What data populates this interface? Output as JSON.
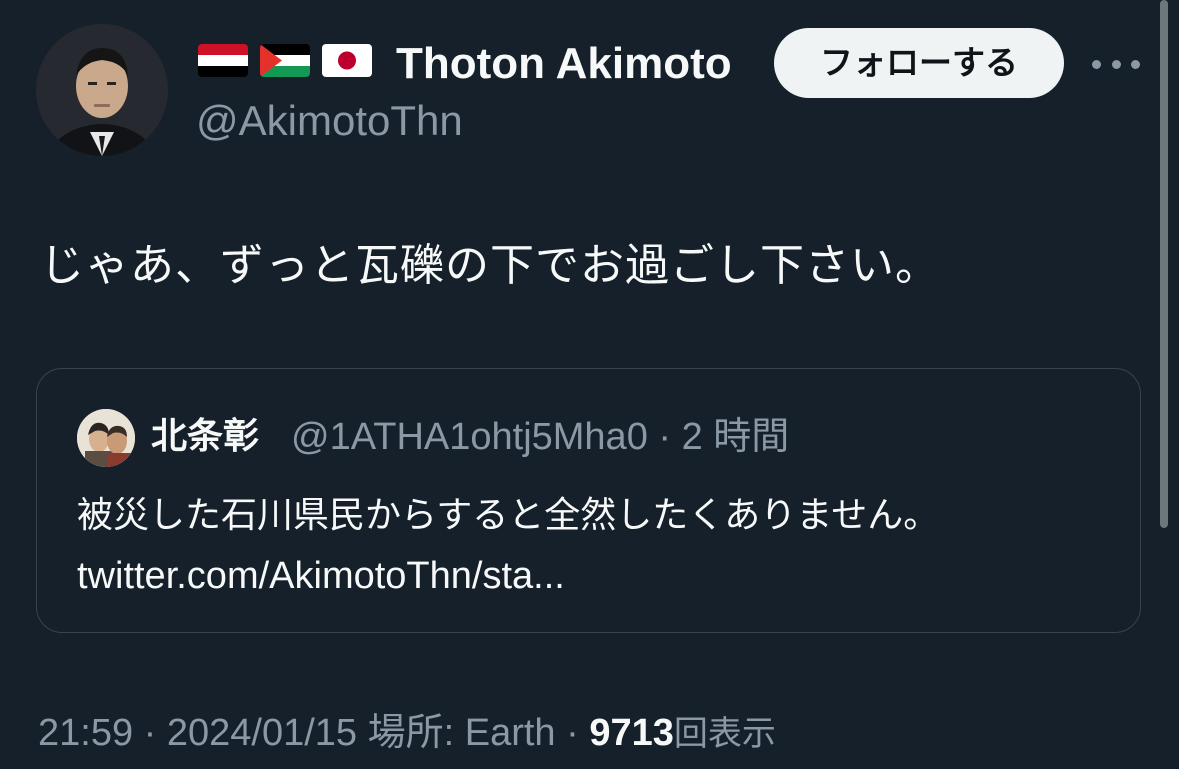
{
  "author": {
    "display_name": "Thoton Akimoto",
    "handle": "@AkimotoThn",
    "flags": [
      "yemen-flag-icon",
      "palestine-flag-icon",
      "japan-flag-icon"
    ]
  },
  "actions": {
    "follow_label": "フォローする",
    "more_icon": "more-horizontal-icon"
  },
  "tweet": {
    "text": "じゃあ、ずっと瓦礫の下でお過ごし下さい。"
  },
  "quote": {
    "name": "北条彰",
    "meta": "@1ATHA1ohtj5Mha0 · 2 時間",
    "text": "被災した石川県民からすると全然したくありません。",
    "link": "twitter.com/AkimotoThn/sta..."
  },
  "footer": {
    "time": "21:59",
    "date": "2024/01/15",
    "location_label": "場所: Earth",
    "views_count": "9713",
    "views_suffix": "回表示"
  },
  "colors": {
    "background": "#15202b",
    "secondary_text": "#8b98a5",
    "button_bg": "#eff3f4"
  }
}
